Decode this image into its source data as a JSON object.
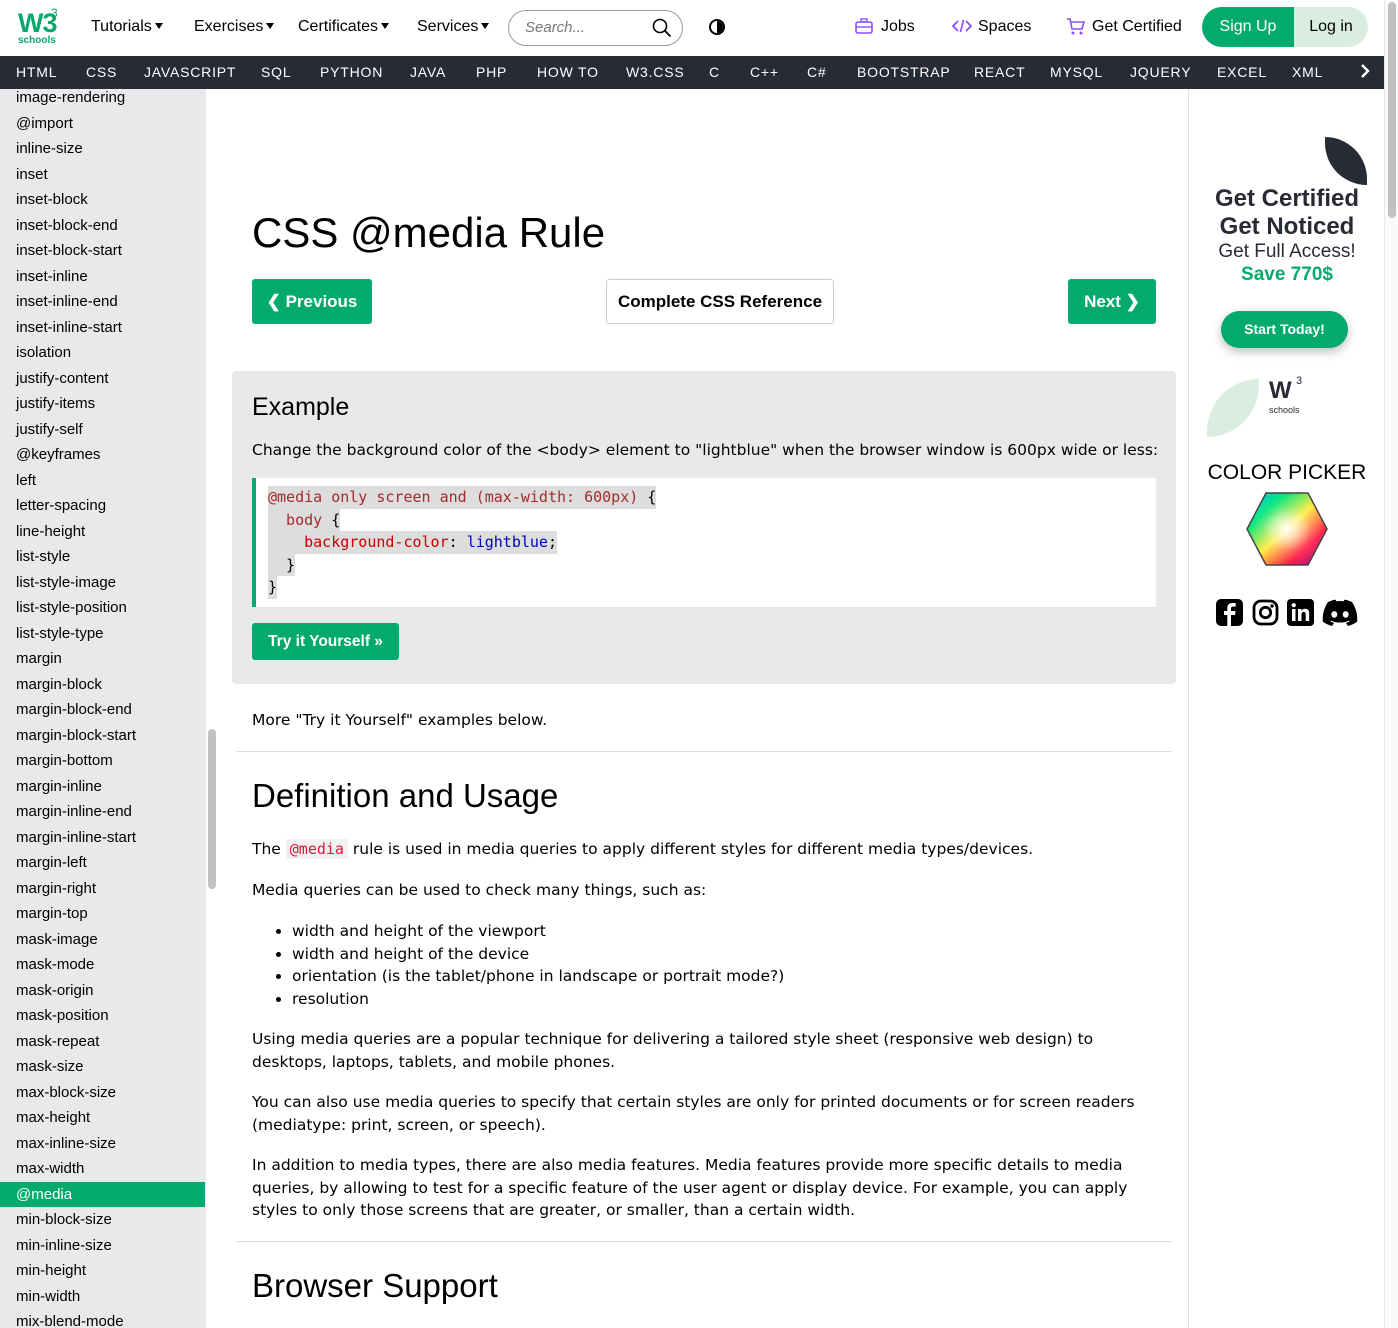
{
  "header": {
    "logo_text": "W3",
    "logo_sup": "3",
    "logo_sub": "schools",
    "nav": [
      "Tutorials",
      "Exercises",
      "Certificates",
      "Services"
    ],
    "search_placeholder": "Search...",
    "jobs": "Jobs",
    "spaces": "Spaces",
    "get_certified": "Get Certified",
    "sign_up": "Sign Up",
    "log_in": "Log in"
  },
  "topnav": [
    "HTML",
    "CSS",
    "JAVASCRIPT",
    "SQL",
    "PYTHON",
    "JAVA",
    "PHP",
    "HOW TO",
    "W3.CSS",
    "C",
    "C++",
    "C#",
    "BOOTSTRAP",
    "REACT",
    "MYSQL",
    "JQUERY",
    "EXCEL",
    "XML"
  ],
  "sidebar": {
    "items": [
      "image-rendering",
      "@import",
      "inline-size",
      "inset",
      "inset-block",
      "inset-block-end",
      "inset-block-start",
      "inset-inline",
      "inset-inline-end",
      "inset-inline-start",
      "isolation",
      "justify-content",
      "justify-items",
      "justify-self",
      "@keyframes",
      "left",
      "letter-spacing",
      "line-height",
      "list-style",
      "list-style-image",
      "list-style-position",
      "list-style-type",
      "margin",
      "margin-block",
      "margin-block-end",
      "margin-block-start",
      "margin-bottom",
      "margin-inline",
      "margin-inline-end",
      "margin-inline-start",
      "margin-left",
      "margin-right",
      "margin-top",
      "mask-image",
      "mask-mode",
      "mask-origin",
      "mask-position",
      "mask-repeat",
      "mask-size",
      "max-block-size",
      "max-height",
      "max-inline-size",
      "max-width",
      "@media",
      "min-block-size",
      "min-inline-size",
      "min-height",
      "min-width",
      "mix-blend-mode"
    ],
    "active": "@media"
  },
  "main": {
    "title": "CSS @media Rule",
    "prev": "❮ Previous",
    "reference": "Complete CSS Reference",
    "next": "Next ❯",
    "example_heading": "Example",
    "example_desc": "Change the background color of the <body> element to \"lightblue\" when the browser window is 600px wide or less:",
    "code": {
      "line1": "@media only screen and (max-width: 600px)",
      "line1_end": " {",
      "line2_sel": "  body",
      "line2_end": " {",
      "line3_prop": "    background-color",
      "line3_colon": ": ",
      "line3_val": "lightblue",
      "line3_end": ";",
      "line4": "  }",
      "line5": "}"
    },
    "try_it": "Try it Yourself »",
    "more_examples": "More \"Try it Yourself\" examples below.",
    "def_heading": "Definition and Usage",
    "def_p1_pre": "The ",
    "def_p1_code": "@media",
    "def_p1_post": " rule is used in media queries to apply different styles for different media types/devices.",
    "def_p2": "Media queries can be used to check many things, such as:",
    "bullets": [
      "width and height of the viewport",
      "width and height of the device",
      "orientation (is the tablet/phone in landscape or portrait mode?)",
      "resolution"
    ],
    "def_p3": "Using media queries are a popular technique for delivering a tailored style sheet (responsive web design) to desktops, laptops, tablets, and mobile phones.",
    "def_p4": "You can also use media queries to specify that certain styles are only for printed documents or for screen readers (mediatype: print, screen, or speech).",
    "def_p5": "In addition to media types, there are also media features. Media features provide more specific details to media queries, by allowing to test for a specific feature of the user agent or display device. For example, you can apply styles to only those screens that are greater, or smaller, than a certain width.",
    "browser_heading": "Browser Support"
  },
  "ad": {
    "line1": "Get Certified",
    "line2": "Get Noticed",
    "line3": "Get Full Access!",
    "line4": "Save 770$",
    "cta": "Start Today!",
    "mini_logo": "W",
    "mini_sup": "3",
    "mini_sub": "schools"
  },
  "color_picker": "COLOR PICKER",
  "colors": {
    "brand": "#04AA6D",
    "dark": "#282A35",
    "sidebar_bg": "#E7E9EB"
  },
  "icons": [
    "search-icon",
    "contrast-icon",
    "jobs-icon",
    "spaces-icon",
    "cart-icon",
    "facebook-icon",
    "instagram-icon",
    "linkedin-icon",
    "discord-icon"
  ]
}
